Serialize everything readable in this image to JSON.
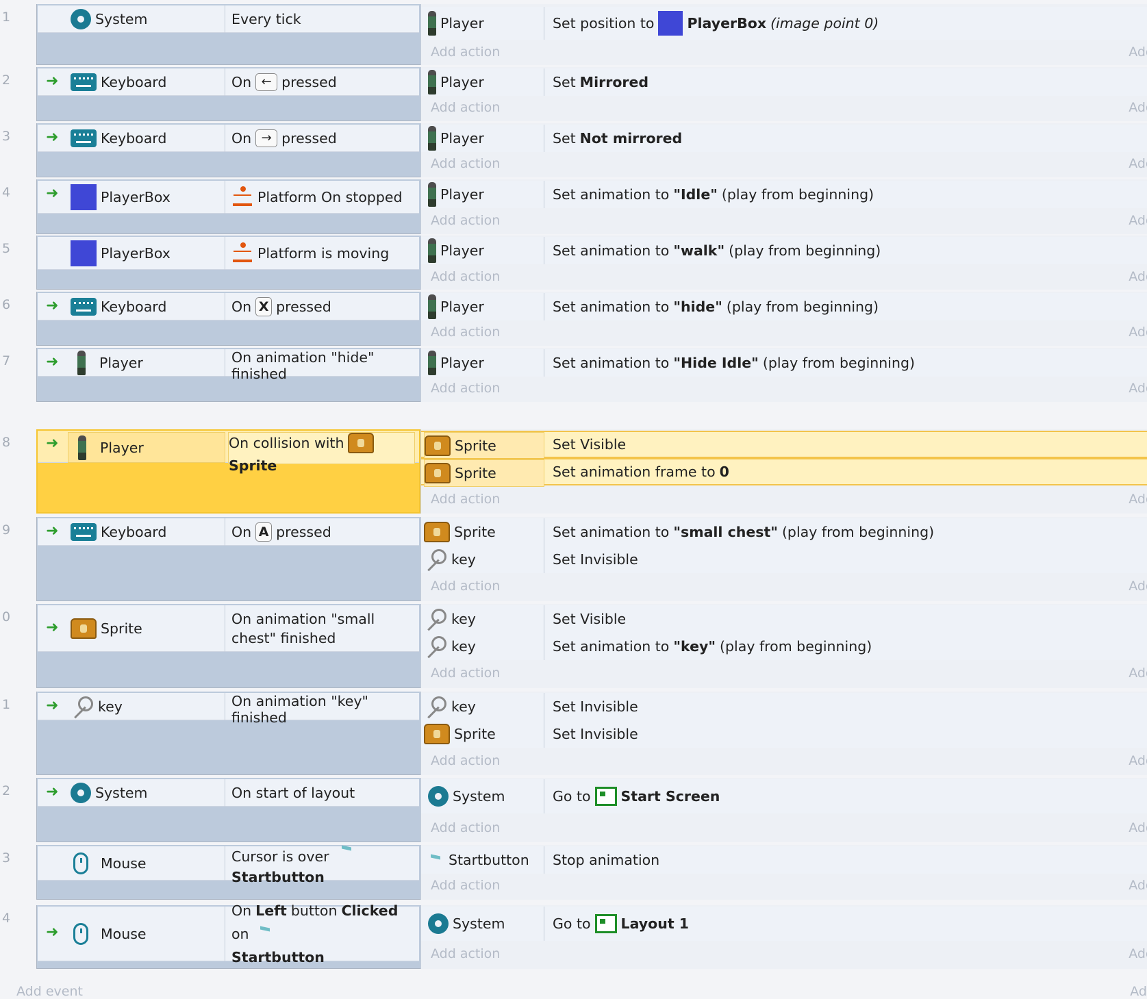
{
  "add_action_label": "Add action",
  "add_right_label": "Add",
  "add_event_label": "Add event",
  "events": [
    {
      "num": "1",
      "cond_obj": "System",
      "cond_text": "Every tick",
      "act1_obj": "Player",
      "act1_pre": "Set position to",
      "act1_bold": "PlayerBox",
      "act1_italic": "(image point 0)"
    },
    {
      "num": "2",
      "cond_obj": "Keyboard",
      "cond_on": "On",
      "cond_key": "←",
      "cond_post": "pressed",
      "act1_obj": "Player",
      "act1_pre": "Set",
      "act1_bold": "Mirrored"
    },
    {
      "num": "3",
      "cond_obj": "Keyboard",
      "cond_on": "On",
      "cond_key": "→",
      "cond_post": "pressed",
      "act1_obj": "Player",
      "act1_pre": "Set",
      "act1_bold": "Not mirrored"
    },
    {
      "num": "4",
      "cond_obj": "PlayerBox",
      "cond_text": "Platform On stopped",
      "act1_obj": "Player",
      "act1_pre": "Set animation to",
      "act1_bold": "\"Idle\"",
      "act1_post": "(play from beginning)"
    },
    {
      "num": "5",
      "cond_obj": "PlayerBox",
      "cond_text": "Platform is moving",
      "act1_obj": "Player",
      "act1_pre": "Set animation to",
      "act1_bold": "\"walk\"",
      "act1_post": "(play from beginning)"
    },
    {
      "num": "6",
      "cond_obj": "Keyboard",
      "cond_on": "On",
      "cond_key": "X",
      "cond_post": "pressed",
      "act1_obj": "Player",
      "act1_pre": "Set animation to",
      "act1_bold": "\"hide\"",
      "act1_post": "(play from beginning)"
    },
    {
      "num": "7",
      "cond_obj": "Player",
      "cond_text": "On animation \"hide\" finished",
      "act1_obj": "Player",
      "act1_pre": "Set animation to",
      "act1_bold": "\"Hide Idle\"",
      "act1_post": "(play from beginning)"
    },
    {
      "num": "8",
      "cond_obj": "Player",
      "cond_pre": "On collision with",
      "cond_bold": "Sprite",
      "act1_obj": "Sprite",
      "act1_pre": "Set Visible",
      "act2_obj": "Sprite",
      "act2_pre": "Set animation frame to",
      "act2_bold": "0"
    },
    {
      "num": "9",
      "cond_obj": "Keyboard",
      "cond_on": "On",
      "cond_key": "A",
      "cond_post": "pressed",
      "act1_obj": "Sprite",
      "act1_pre": "Set animation to",
      "act1_bold": "\"small chest\"",
      "act1_post": "(play from beginning)",
      "act2_obj": "key",
      "act2_pre": "Set Invisible"
    },
    {
      "num": "0",
      "cond_obj": "Sprite",
      "cond_text": "On animation \"small chest\" finished",
      "act1_obj": "key",
      "act1_pre": "Set Visible",
      "act2_obj": "key",
      "act2_pre": "Set animation to",
      "act2_bold": "\"key\"",
      "act2_post": "(play from beginning)"
    },
    {
      "num": "1",
      "cond_obj": "key",
      "cond_text": "On animation \"key\" finished",
      "act1_obj": "key",
      "act1_pre": "Set Invisible",
      "act2_obj": "Sprite",
      "act2_pre": "Set Invisible"
    },
    {
      "num": "2",
      "cond_obj": "System",
      "cond_text": "On start of layout",
      "act1_obj": "System",
      "act1_pre": "Go to",
      "act1_bold": "Start Screen"
    },
    {
      "num": "3",
      "cond_obj": "Mouse",
      "cond_pre": "Cursor is over",
      "cond_bold": "Startbutton",
      "act1_obj": "Startbutton",
      "act1_pre": "Stop animation"
    },
    {
      "num": "4",
      "cond_obj": "Mouse",
      "cond_w1": "On",
      "cond_w2": "Left",
      "cond_w3": "button",
      "cond_w4": "Clicked",
      "cond_w5": "on",
      "cond_bold": "Startbutton",
      "act1_obj": "System",
      "act1_pre": "Go to",
      "act1_bold": "Layout 1"
    }
  ]
}
